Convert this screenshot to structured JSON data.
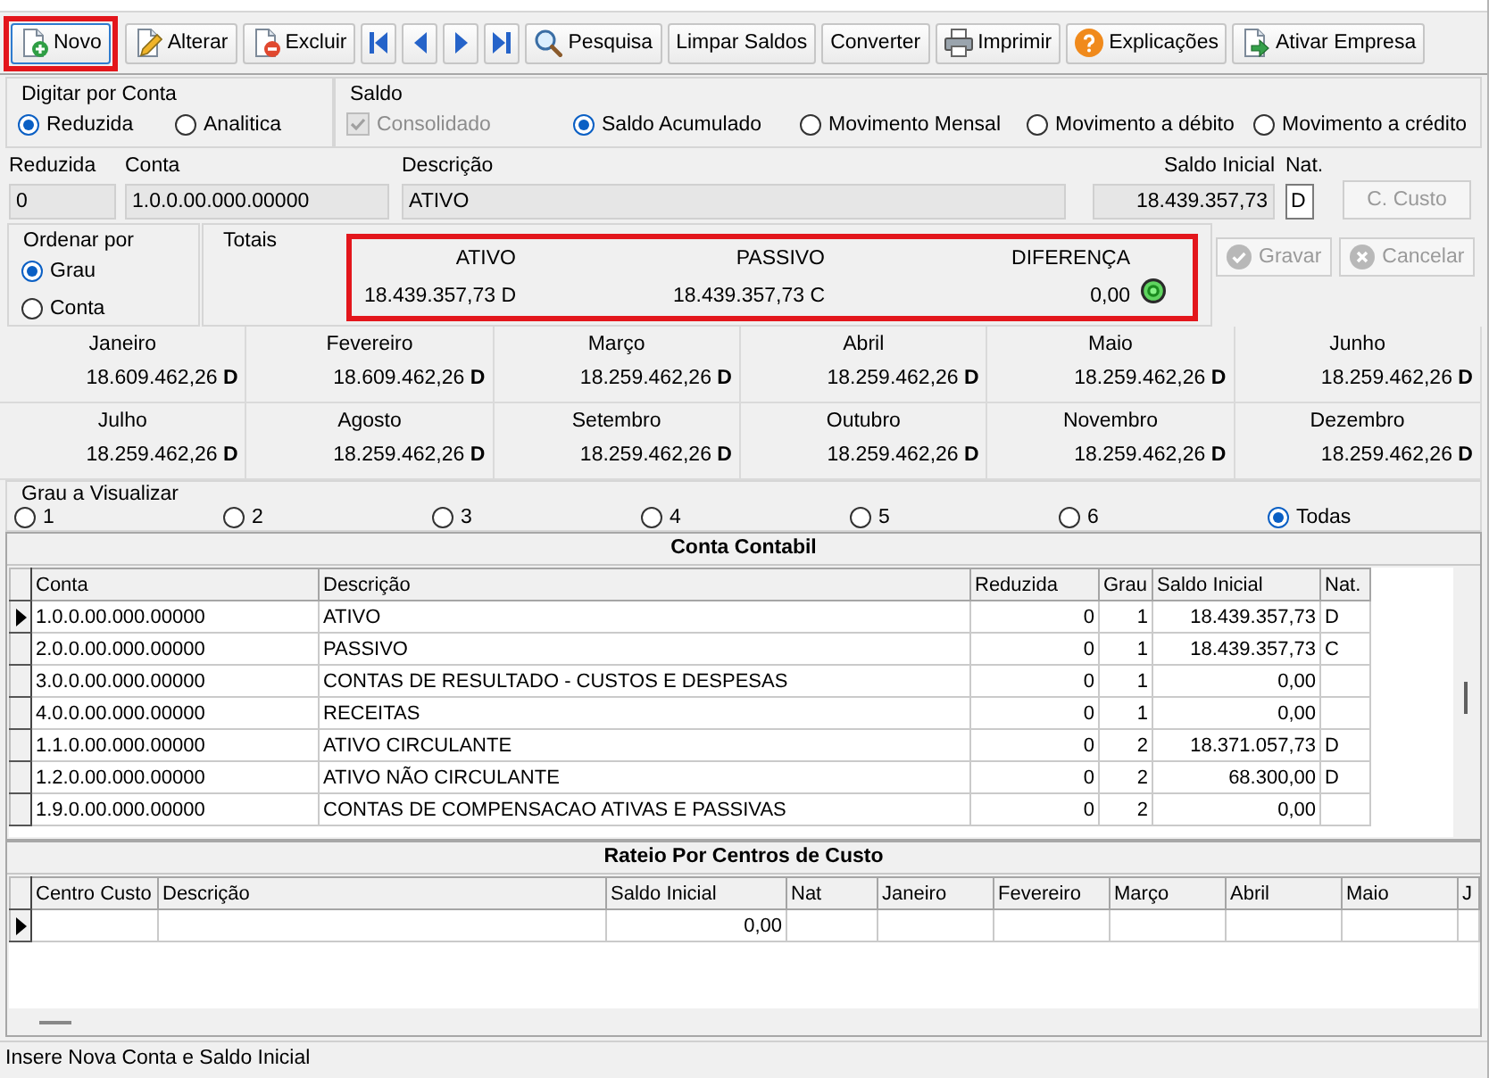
{
  "toolbar": [
    {
      "kind": "new",
      "label": "Novo",
      "highlighted": true,
      "focused": true
    },
    {
      "kind": "edit",
      "label": "Alterar",
      "highlighted": false,
      "focused": false
    },
    {
      "kind": "delete",
      "label": "Excluir",
      "highlighted": false,
      "focused": false
    },
    {
      "kind": "first",
      "highlighted": false,
      "focused": false
    },
    {
      "kind": "prev",
      "highlighted": false,
      "focused": false
    },
    {
      "kind": "next",
      "highlighted": false,
      "focused": false
    },
    {
      "kind": "last",
      "highlighted": false,
      "focused": false
    },
    {
      "kind": "search",
      "label": "Pesquisa",
      "highlighted": false,
      "focused": false
    },
    {
      "kind": "clear",
      "label": "Limpar Saldos",
      "highlighted": false,
      "focused": false
    },
    {
      "kind": "convert",
      "label": "Converter",
      "highlighted": false,
      "focused": false
    },
    {
      "kind": "print",
      "label": "Imprimir",
      "highlighted": false,
      "focused": false
    },
    {
      "kind": "help",
      "label": "Explicações",
      "highlighted": false,
      "focused": false
    },
    {
      "kind": "activate",
      "label": "Ativar Empresa",
      "highlighted": false,
      "focused": false
    }
  ],
  "digitar_por_conta": {
    "title": "Digitar por Conta",
    "options": [
      {
        "label": "Reduzida",
        "selected": true
      },
      {
        "label": "Analitica",
        "selected": false
      }
    ]
  },
  "saldo": {
    "title": "Saldo",
    "consolidado": {
      "label": "Consolidado",
      "checked": true,
      "disabled": true
    },
    "options": [
      {
        "label": "Saldo Acumulado",
        "selected": true
      },
      {
        "label": "Movimento Mensal",
        "selected": false
      },
      {
        "label": "Movimento a débito",
        "selected": false
      },
      {
        "label": "Movimento a crédito",
        "selected": false
      }
    ]
  },
  "account_fields": [
    {
      "label": "Reduzida",
      "value": "0",
      "readonly": true
    },
    {
      "label": "Conta",
      "value": "1.0.0.00.000.00000",
      "readonly": true
    },
    {
      "label": "Descrição",
      "value": "ATIVO",
      "readonly": true
    },
    {
      "label": "Saldo Inicial",
      "value": "18.439.357,73",
      "readonly": true
    },
    {
      "label": "Nat.",
      "value": "D",
      "readonly": false
    }
  ],
  "c_custo_button": {
    "label": "C. Custo",
    "disabled": true
  },
  "ordenar_por": {
    "title": "Ordenar por",
    "options": [
      {
        "label": "Grau",
        "selected": true
      },
      {
        "label": "Conta",
        "selected": false
      }
    ]
  },
  "totais": {
    "title": "Totais",
    "highlighted": true,
    "balanced": true,
    "columns": [
      {
        "label": "ATIVO",
        "value": "18.439.357,73 D"
      },
      {
        "label": "PASSIVO",
        "value": "18.439.357,73 C"
      },
      {
        "label": "DIFERENÇA",
        "value": "0,00"
      }
    ]
  },
  "actions": [
    {
      "kind": "save",
      "label": "Gravar",
      "disabled": true
    },
    {
      "kind": "cancel",
      "label": "Cancelar",
      "disabled": true
    }
  ],
  "months": [
    {
      "label": "Janeiro",
      "value": "18.609.462,26 **D**"
    },
    {
      "label": "Fevereiro",
      "value": "18.609.462,26 **D**"
    },
    {
      "label": "Março",
      "value": "18.259.462,26 **D**"
    },
    {
      "label": "Abril",
      "value": "18.259.462,26 **D**"
    },
    {
      "label": "Maio",
      "value": "18.259.462,26 **D**"
    },
    {
      "label": "Junho",
      "value": "18.259.462,26 **D**"
    },
    {
      "label": "Julho",
      "value": "18.259.462,26 **D**"
    },
    {
      "label": "Agosto",
      "value": "18.259.462,26 **D**"
    },
    {
      "label": "Setembro",
      "value": "18.259.462,26 **D**"
    },
    {
      "label": "Outubro",
      "value": "18.259.462,26 **D**"
    },
    {
      "label": "Novembro",
      "value": "18.259.462,26 **D**"
    },
    {
      "label": "Dezembro",
      "value": "18.259.462,26 **D**"
    }
  ],
  "grau_a_visualizar": {
    "title": "Grau a Visualizar",
    "options": [
      {
        "label": "1",
        "selected": false
      },
      {
        "label": "2",
        "selected": false
      },
      {
        "label": "3",
        "selected": false
      },
      {
        "label": "4",
        "selected": false
      },
      {
        "label": "5",
        "selected": false
      },
      {
        "label": "6",
        "selected": false
      },
      {
        "label": "Todas",
        "selected": true
      }
    ]
  },
  "conta_contabil": {
    "title": "Conta Contabil",
    "columns": [
      "Conta",
      "Descrição",
      "Reduzida",
      "Grau",
      "Saldo Inicial",
      "Nat."
    ],
    "rows": [
      {
        "selected": true,
        "conta": "1.0.0.00.000.00000",
        "descricao": "ATIVO",
        "reduzida": "0",
        "grau": "1",
        "saldo_inicial": "18.439.357,73",
        "nat": "D"
      },
      {
        "selected": false,
        "conta": "2.0.0.00.000.00000",
        "descricao": "PASSIVO",
        "reduzida": "0",
        "grau": "1",
        "saldo_inicial": "18.439.357,73",
        "nat": "C"
      },
      {
        "selected": false,
        "conta": "3.0.0.00.000.00000",
        "descricao": "CONTAS DE RESULTADO - CUSTOS E DESPESAS",
        "reduzida": "0",
        "grau": "1",
        "saldo_inicial": "0,00"
      },
      {
        "selected": false,
        "conta": "4.0.0.00.000.00000",
        "descricao": "RECEITAS",
        "reduzida": "0",
        "grau": "1",
        "saldo_inicial": "0,00"
      },
      {
        "selected": false,
        "conta": "1.1.0.00.000.00000",
        "descricao": "ATIVO CIRCULANTE",
        "reduzida": "0",
        "grau": "2",
        "saldo_inicial": "18.371.057,73",
        "nat": "D"
      },
      {
        "selected": false,
        "conta": "1.2.0.00.000.00000",
        "descricao": "ATIVO NÃO CIRCULANTE",
        "reduzida": "0",
        "grau": "2",
        "saldo_inicial": "68.300,00",
        "nat": "D"
      },
      {
        "selected": false,
        "conta": "1.9.0.00.000.00000",
        "descricao": "CONTAS DE COMPENSACAO ATIVAS E PASSIVAS",
        "reduzida": "0",
        "grau": "2",
        "saldo_inicial": "0,00"
      }
    ]
  },
  "rateio": {
    "title": "Rateio Por Centros de Custo",
    "columns": [
      "Centro Custo",
      "Descrição",
      "Saldo Inicial",
      "Nat",
      "Janeiro",
      "Fevereiro",
      "Março",
      "Abril",
      "Maio",
      "J"
    ],
    "rows": [
      {
        "selected": true,
        "saldo_inicial": "0,00"
      }
    ]
  },
  "status_bar": {
    "text": "Insere Nova Conta e Saldo Inicial"
  }
}
